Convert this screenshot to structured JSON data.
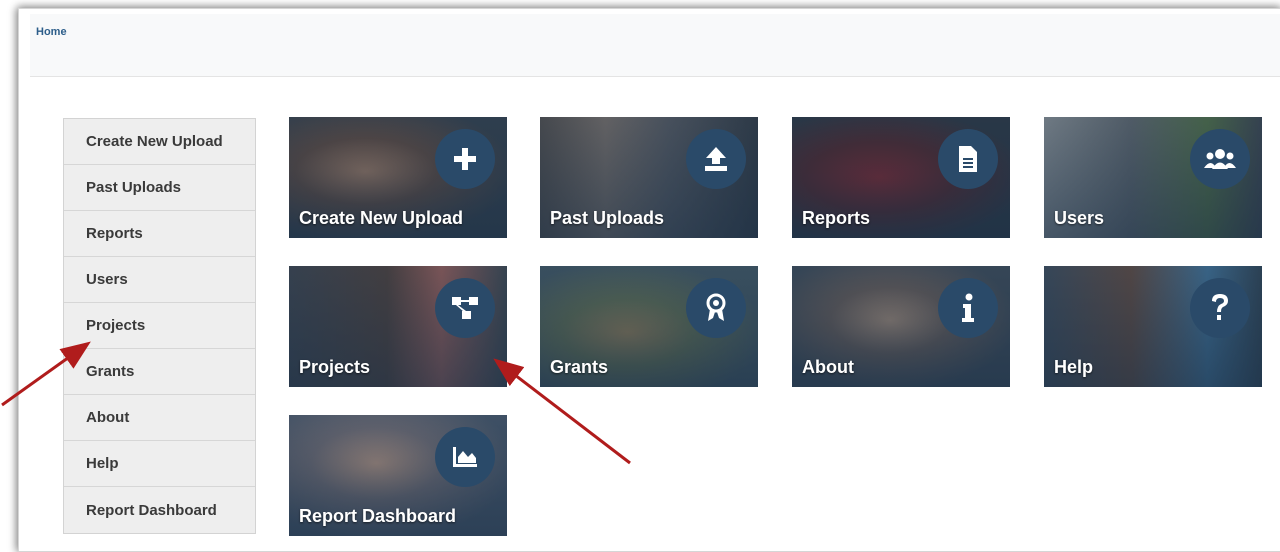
{
  "breadcrumb": {
    "home": "Home"
  },
  "sidebar": {
    "items": [
      {
        "label": "Create New Upload"
      },
      {
        "label": "Past Uploads"
      },
      {
        "label": "Reports"
      },
      {
        "label": "Users"
      },
      {
        "label": "Projects"
      },
      {
        "label": "Grants"
      },
      {
        "label": "About"
      },
      {
        "label": "Help"
      },
      {
        "label": "Report Dashboard"
      }
    ]
  },
  "tiles": [
    {
      "label": "Create New Upload",
      "icon": "plus-icon"
    },
    {
      "label": "Past Uploads",
      "icon": "upload-icon"
    },
    {
      "label": "Reports",
      "icon": "document-icon"
    },
    {
      "label": "Users",
      "icon": "users-icon"
    },
    {
      "label": "Projects",
      "icon": "hierarchy-icon"
    },
    {
      "label": "Grants",
      "icon": "award-icon"
    },
    {
      "label": "About",
      "icon": "info-icon"
    },
    {
      "label": "Help",
      "icon": "question-icon"
    },
    {
      "label": "Report Dashboard",
      "icon": "area-chart-icon"
    }
  ],
  "colors": {
    "accent_link": "#2d5e8a",
    "icon_circle": "#2a4a69",
    "annotation_arrow": "#b01c1c"
  }
}
